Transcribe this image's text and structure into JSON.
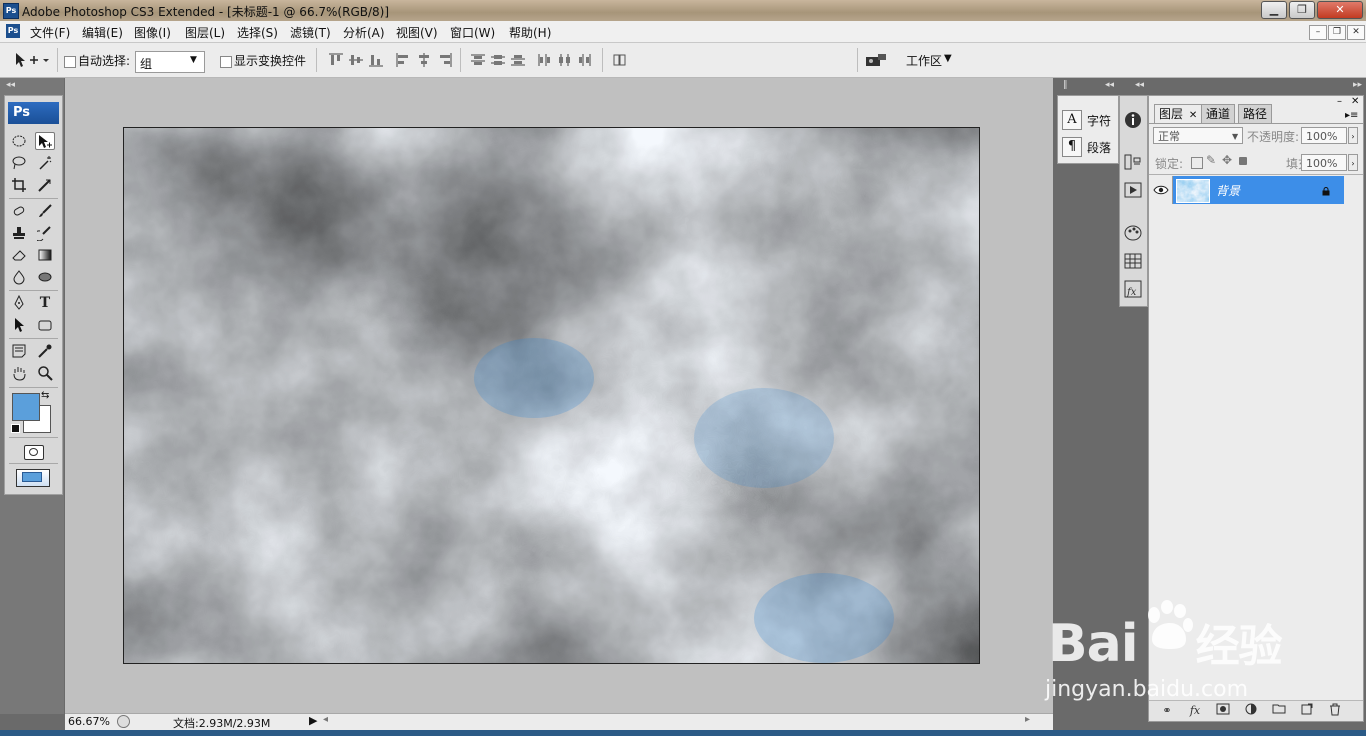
{
  "window": {
    "title": "Adobe Photoshop CS3 Extended - [未标题-1 @ 66.7%(RGB/8)]",
    "app_badge": "Ps"
  },
  "menu": [
    "文件(F)",
    "编辑(E)",
    "图像(I)",
    "图层(L)",
    "选择(S)",
    "滤镜(T)",
    "分析(A)",
    "视图(V)",
    "窗口(W)",
    "帮助(H)"
  ],
  "options": {
    "auto_select_label": "自动选择:",
    "auto_select_value": "组",
    "show_transform_label": "显示变换控件",
    "workspace_label": "工作区"
  },
  "toolbox": {
    "badge": "Ps",
    "foreground_color": "#5b9fdb",
    "background_color": "#ffffff"
  },
  "status": {
    "zoom": "66.67%",
    "doc_info": "文档:2.93M/2.93M"
  },
  "char_panel": {
    "character_label": "字符",
    "paragraph_label": "段落"
  },
  "layers_panel": {
    "tabs": [
      "图层",
      "通道",
      "路径"
    ],
    "blend_mode": "正常",
    "opacity_label": "不透明度:",
    "opacity_value": "100%",
    "lock_label": "锁定:",
    "fill_label": "填充:",
    "fill_value": "100%",
    "layer_name": "背景",
    "selected_color": "#3d8ee8"
  },
  "watermark": {
    "brand": "Bai",
    "brand_cn": "经验",
    "url": "jingyan.baidu.com"
  }
}
